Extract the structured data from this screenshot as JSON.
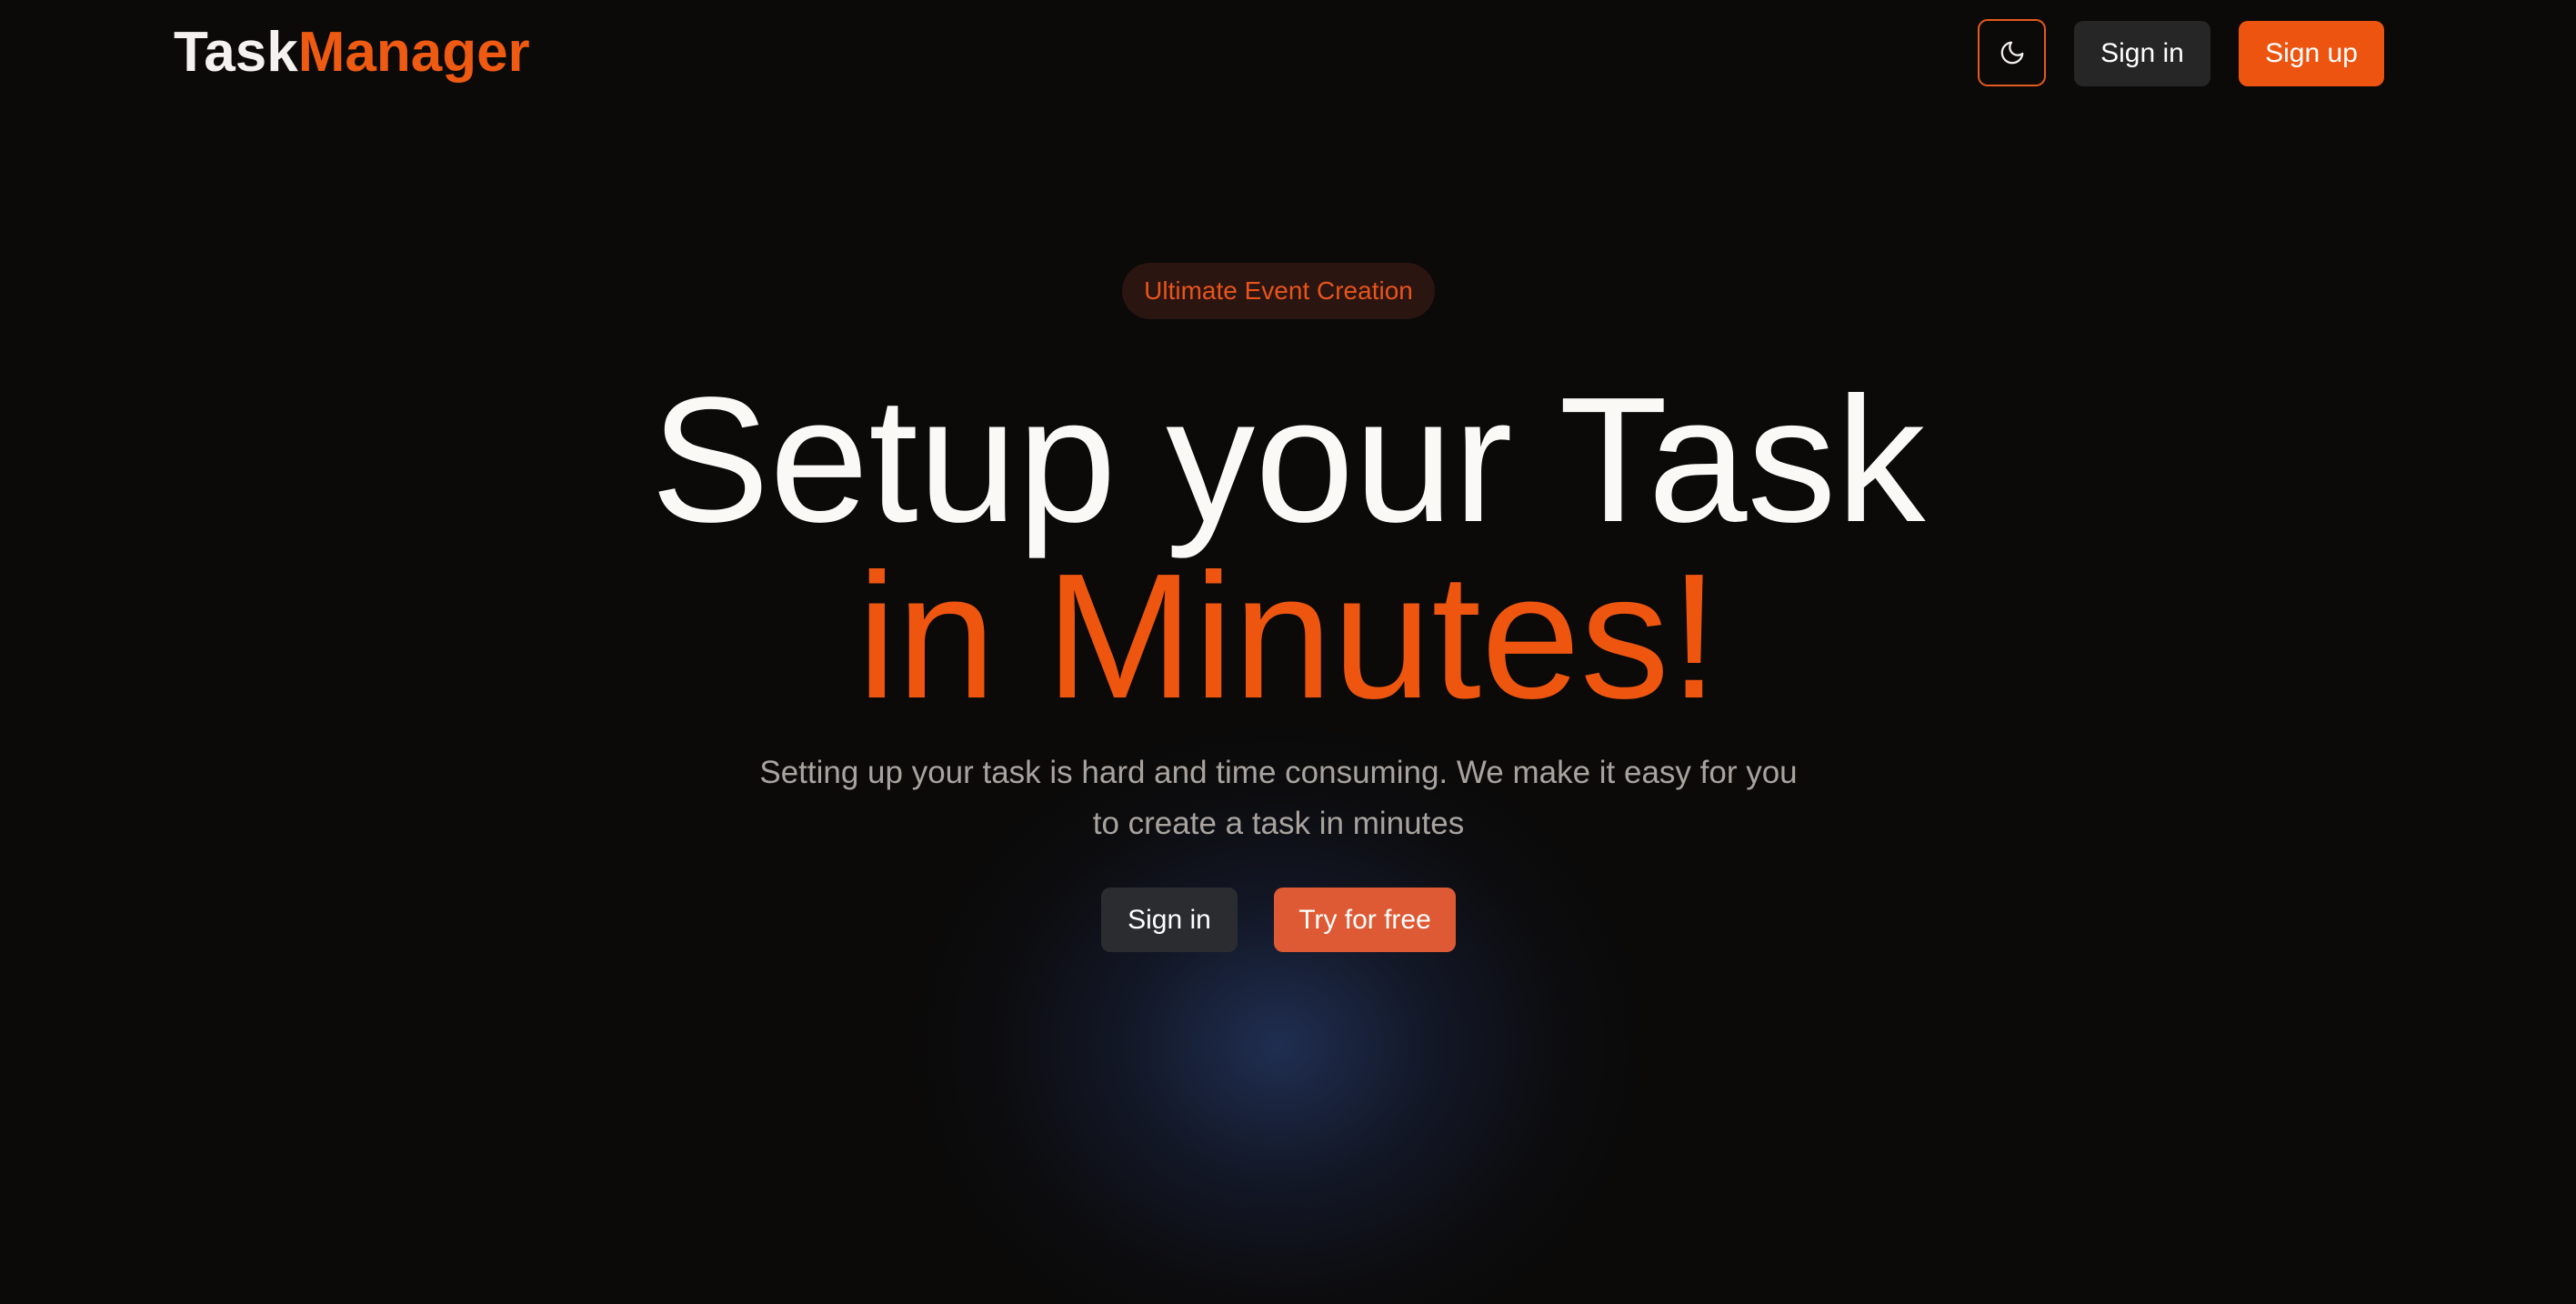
{
  "brand": {
    "part1": "Task",
    "part2": "Manager",
    "color_primary": "#f4f1ee",
    "color_accent": "#ef5a12"
  },
  "nav": {
    "theme_toggle_icon": "moon-icon",
    "sign_in_label": "Sign in",
    "sign_up_label": "Sign up"
  },
  "hero": {
    "badge": "Ultimate Event Creation",
    "headline_line1": "Setup your Task",
    "headline_line2": "in Minutes!",
    "subtitle": "Setting up your task is hard and time consuming. We make it easy for you to create a task in minutes",
    "sign_in_label": "Sign in",
    "try_label": "Try for free"
  },
  "colors": {
    "background": "#0b0a09",
    "accent": "#ec5410",
    "button_dark": "#262626",
    "try_button": "#de5a34"
  }
}
